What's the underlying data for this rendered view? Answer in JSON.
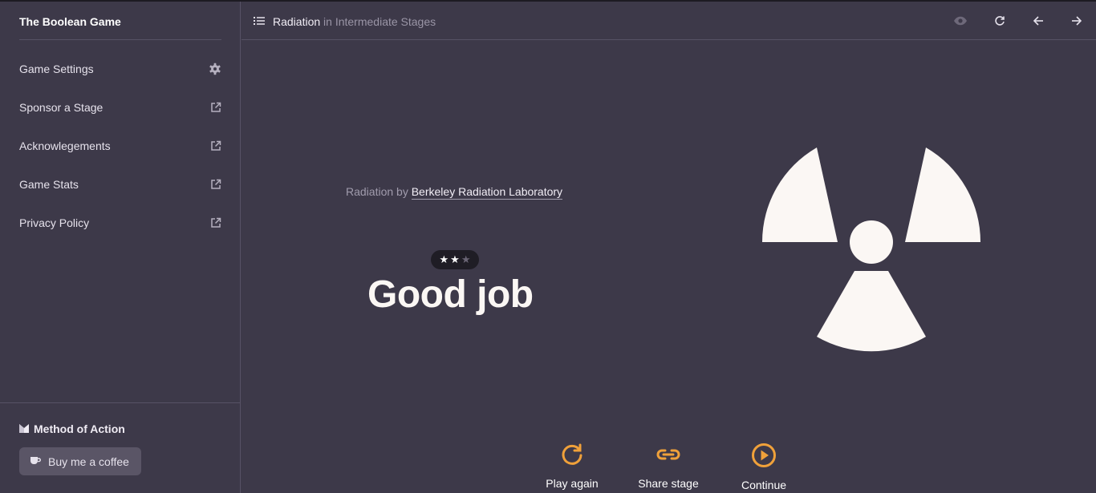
{
  "app": {
    "title": "The Boolean Game"
  },
  "sidebar": {
    "items": [
      {
        "label": "Game Settings",
        "icon": "gear-icon"
      },
      {
        "label": "Sponsor a Stage",
        "icon": "external-link-icon"
      },
      {
        "label": "Acknowlegements",
        "icon": "external-link-icon"
      },
      {
        "label": "Game Stats",
        "icon": "external-link-icon"
      },
      {
        "label": "Privacy Policy",
        "icon": "external-link-icon"
      }
    ],
    "footer": {
      "brand": "Method of Action",
      "coffee_label": "Buy me a coffee"
    }
  },
  "header": {
    "stage_name": "Radiation",
    "collection": "in Intermediate Stages",
    "buttons": [
      "eye-icon",
      "refresh-icon",
      "arrow-left-icon",
      "arrow-right-icon"
    ]
  },
  "main": {
    "byline_prefix": "Radiation by",
    "byline_author": "Berkeley Radiation Laboratory",
    "stars": {
      "earned": 2,
      "total": 3
    },
    "result": "Good job",
    "emblem": "radiation-trefoil-icon",
    "actions": [
      {
        "label": "Play again",
        "icon": "replay-icon"
      },
      {
        "label": "Share stage",
        "icon": "link-icon"
      },
      {
        "label": "Continue",
        "icon": "play-circle-icon"
      }
    ]
  },
  "colors": {
    "background": "#3d3949",
    "accent": "#f0a13a",
    "shape": "#fbf7f4",
    "border": "#575265"
  }
}
